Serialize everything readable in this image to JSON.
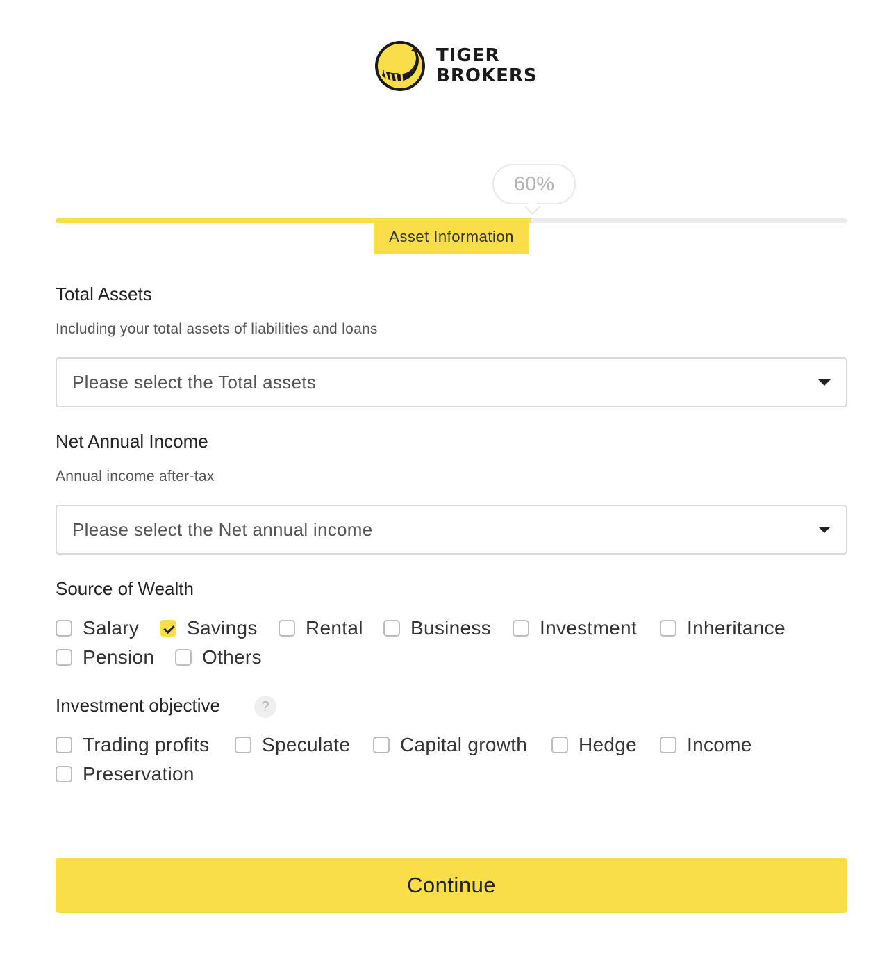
{
  "brand": {
    "line1": "TIGER",
    "line2": "BROKERS",
    "accent_color": "#f9de49",
    "logo_icon": "tiger-logo-icon"
  },
  "progress": {
    "percent_label": "60%",
    "value": 0.6,
    "step_label": "Asset Information"
  },
  "total_assets": {
    "title": "Total Assets",
    "hint": "Including your total assets of liabilities and loans",
    "placeholder": "Please select the Total assets"
  },
  "net_income": {
    "title": "Net Annual Income",
    "hint": "Annual income after-tax",
    "placeholder": "Please select the Net annual income"
  },
  "wealth": {
    "title": "Source of Wealth",
    "options": [
      {
        "label": "Salary",
        "checked": false
      },
      {
        "label": "Savings",
        "checked": true
      },
      {
        "label": "Rental",
        "checked": false
      },
      {
        "label": "Business",
        "checked": false
      },
      {
        "label": "Investment",
        "checked": false
      },
      {
        "label": "Inheritance",
        "checked": false
      },
      {
        "label": "Pension",
        "checked": false
      },
      {
        "label": "Others",
        "checked": false
      }
    ]
  },
  "objective": {
    "title": "Investment objective",
    "help": "?",
    "options": [
      {
        "label": "Trading profits",
        "checked": false
      },
      {
        "label": "Speculate",
        "checked": false
      },
      {
        "label": "Capital growth",
        "checked": false
      },
      {
        "label": "Hedge",
        "checked": false
      },
      {
        "label": "Income",
        "checked": false
      },
      {
        "label": "Preservation",
        "checked": false
      }
    ]
  },
  "continue_label": "Continue"
}
